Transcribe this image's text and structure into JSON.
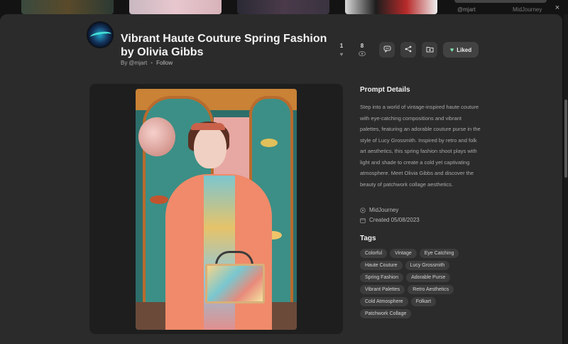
{
  "background": {
    "username": "@mjart",
    "model": "MidJourney"
  },
  "modal": {
    "close_icon": "×",
    "title": "Vibrant Haute Couture Spring Fashion by Olivia Gibbs",
    "byline": {
      "prefix": "By",
      "author": "@mjart",
      "separator": "•",
      "follow": "Follow"
    },
    "stats": {
      "likes": "1",
      "views": "8"
    },
    "actions": {
      "liked_label": "Liked"
    }
  },
  "details": {
    "prompt_heading": "Prompt Details",
    "prompt_text": "Step into a world of vintage-inspired haute couture with eye-catching compositions and vibrant palettes, featuring an adorable couture purse in the style of Lucy Grossmith. Inspired by retro and folk art aesthetics, this spring fashion shoot plays with light and shade to create a cold yet captivating atmosphere. Meet Olivia Gibbs and discover the beauty of patchwork collage aesthetics.",
    "model": "MidJourney",
    "created": "Created 05/08/2023",
    "tags_heading": "Tags",
    "tags": [
      "Colorful",
      "Vintage",
      "Eye Catching",
      "Haute Couture",
      "Lucy Grossmith",
      "Spring Fashion",
      "Adorable Purse",
      "Vibrant Palettes",
      "Retro Aesthetics",
      "Cold Atmosphere",
      "Folkart",
      "Patchwork Collage"
    ]
  },
  "colors": {
    "modal_bg": "#2b2b2b",
    "liked_heart": "#7fe3b0",
    "tag_bg": "#3d3d3d"
  }
}
